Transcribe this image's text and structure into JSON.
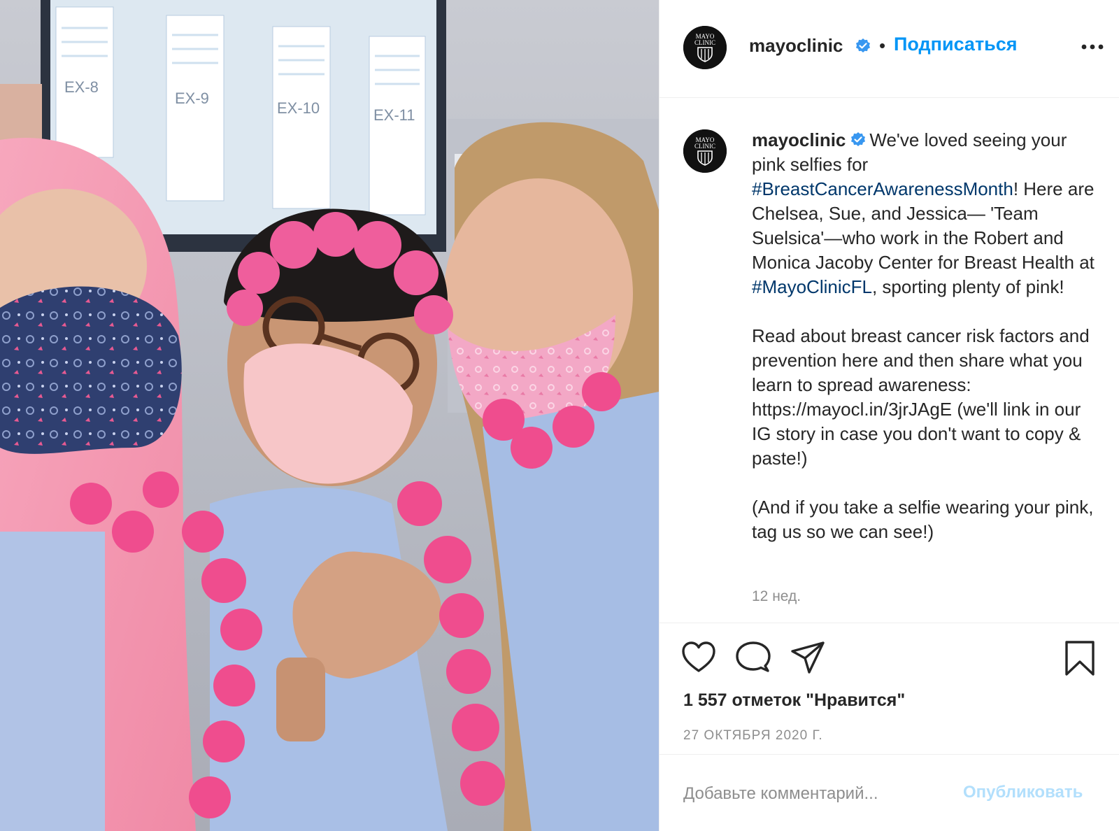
{
  "post": {
    "username": "mayoclinic",
    "verified_icon": "verified-badge-icon",
    "separator": "•",
    "follow_label": "Подписаться",
    "avatar_text": [
      "MAYO",
      "CLINIC"
    ],
    "caption": {
      "intro": "We've loved seeing your pink selfies for ",
      "hashtag1": "#BreastCancerAwarenessMonth",
      "part2": "! Here are Chelsea, Sue, and Jessica— 'Team Suelsica'—who work in the Robert and Monica Jacoby Center for Breast Health at ",
      "hashtag2": "#MayoClinicFL",
      "part3": ", sporting plenty of pink!",
      "paragraph2": "Read about breast cancer risk factors and prevention here and then share what you learn to spread awareness: https://mayocl.in/3jrJAgE (we'll link in our IG story in case you don't want to copy & paste!)",
      "paragraph3": "(And if you take a selfie wearing your pink, tag us so we can see!)"
    },
    "time_ago": "12 нед.",
    "likes_text": "1 557 отметок \"Нравится\"",
    "date": "27 ОКТЯБРЯ 2020 Г.",
    "photo_labels": [
      "EX-8",
      "EX-9",
      "EX-10",
      "EX-11"
    ]
  },
  "actions": {
    "like_icon": "heart-icon",
    "comment_icon": "comment-icon",
    "share_icon": "paper-plane-icon",
    "save_icon": "bookmark-icon"
  },
  "comment": {
    "placeholder": "Добавьте комментарий...",
    "publish_label": "Опубликовать"
  },
  "colors": {
    "accent": "#0095f6",
    "hashtag": "#00376b",
    "muted": "#8e8e8e",
    "publish_disabled": "#b2dffc"
  }
}
